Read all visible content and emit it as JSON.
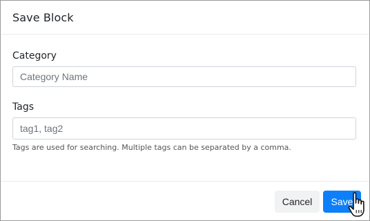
{
  "modal": {
    "title": "Save Block"
  },
  "category": {
    "label": "Category",
    "value": "",
    "placeholder": "Category Name"
  },
  "tags": {
    "label": "Tags",
    "value": "",
    "placeholder": "tag1, tag2",
    "help_text": "Tags are used for searching. Multiple tags can be separated by a comma."
  },
  "footer": {
    "cancel_label": "Cancel",
    "save_label": "Save"
  },
  "colors": {
    "primary": "#0d7ffa",
    "secondary_bg": "#f1f2f3"
  },
  "cursor_icon": "hand-pointer-icon"
}
